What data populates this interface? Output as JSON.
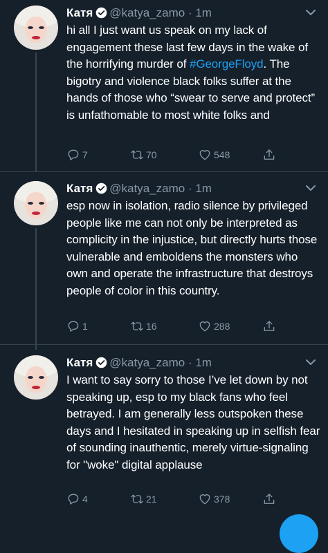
{
  "tweets": [
    {
      "name": "Катя",
      "handle": "@katya_zamo",
      "time": "1m",
      "text_before": "hi all I just want us speak on my lack of engagement these last few days in the wake of the horrifying murder of ",
      "hashtag": "#GeorgeFloyd",
      "text_after": ". The bigotry and violence black folks suffer at the hands of those who “swear to serve and protect” is unfathomable to most white folks and",
      "replies": "7",
      "retweets": "70",
      "likes": "548"
    },
    {
      "name": "Катя",
      "handle": "@katya_zamo",
      "time": "1m",
      "text_before": "esp now in isolation, radio silence by privileged people like me can not only be interpreted as complicity in the injustice, but directly hurts those vulnerable and emboldens the monsters who own and operate the infrastructure that destroys people of color in this country.",
      "hashtag": "",
      "text_after": "",
      "replies": "1",
      "retweets": "16",
      "likes": "288"
    },
    {
      "name": "Катя",
      "handle": "@katya_zamo",
      "time": "1m",
      "text_before": "I want to say sorry to those I’ve let down by not speaking up, esp to my black fans who feel betrayed. I am generally less outspoken these days and I hesitated in speaking up in selfish fear of sounding inauthentic, merely virtue-signaling for \"woke\" digital applause",
      "hashtag": "",
      "text_after": "",
      "replies": "4",
      "retweets": "21",
      "likes": "378"
    }
  ],
  "colors": {
    "background": "#15202b",
    "text": "#ffffff",
    "secondary": "#8899a6",
    "accent": "#1da1f2",
    "divider": "#38444d"
  },
  "icons": [
    "verified-badge-icon",
    "chevron-down-icon",
    "reply-icon",
    "retweet-icon",
    "like-icon",
    "share-icon"
  ]
}
